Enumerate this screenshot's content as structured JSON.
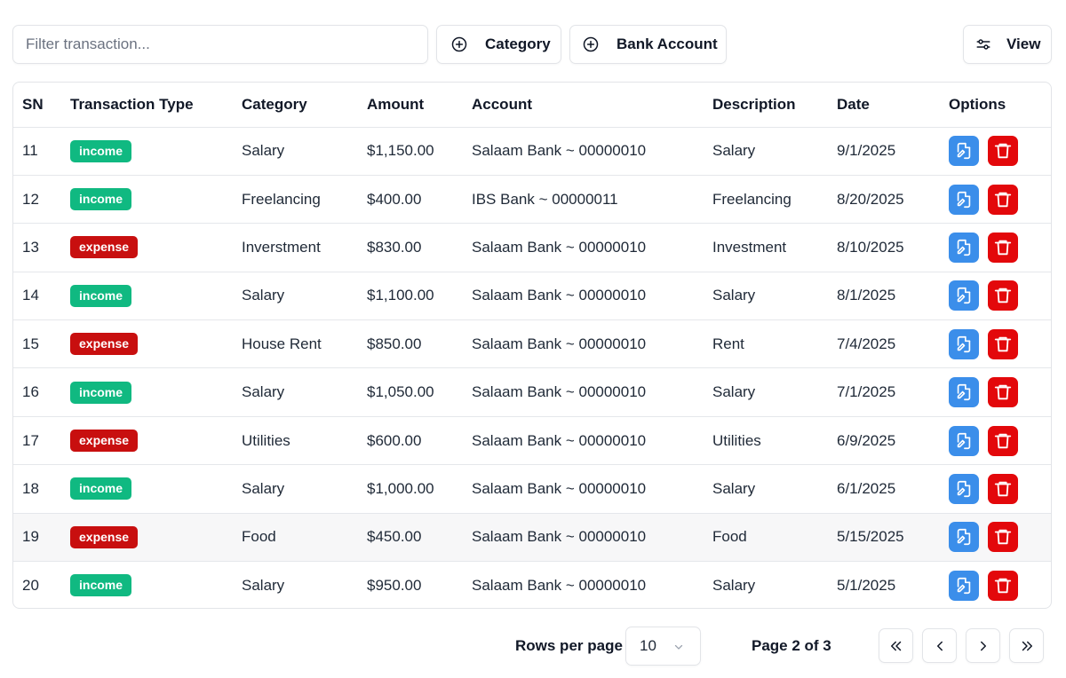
{
  "toolbar": {
    "filter_placeholder": "Filter transaction...",
    "category_label": "Category",
    "bank_account_label": "Bank Account",
    "view_label": "View"
  },
  "table": {
    "headers": [
      "SN",
      "Transaction Type",
      "Category",
      "Amount",
      "Account",
      "Description",
      "Date",
      "Options"
    ],
    "rows": [
      {
        "sn": "11",
        "type": "income",
        "category": "Salary",
        "amount": "$1,150.00",
        "account": "Salaam Bank ~ 00000010",
        "description": "Salary",
        "date": "9/1/2025"
      },
      {
        "sn": "12",
        "type": "income",
        "category": "Freelancing",
        "amount": "$400.00",
        "account": "IBS Bank ~ 00000011",
        "description": "Freelancing",
        "date": "8/20/2025"
      },
      {
        "sn": "13",
        "type": "expense",
        "category": "Inverstment",
        "amount": "$830.00",
        "account": "Salaam Bank ~ 00000010",
        "description": "Investment",
        "date": "8/10/2025"
      },
      {
        "sn": "14",
        "type": "income",
        "category": "Salary",
        "amount": "$1,100.00",
        "account": "Salaam Bank ~ 00000010",
        "description": "Salary",
        "date": "8/1/2025"
      },
      {
        "sn": "15",
        "type": "expense",
        "category": "House Rent",
        "amount": "$850.00",
        "account": "Salaam Bank ~ 00000010",
        "description": "Rent",
        "date": "7/4/2025"
      },
      {
        "sn": "16",
        "type": "income",
        "category": "Salary",
        "amount": "$1,050.00",
        "account": "Salaam Bank ~ 00000010",
        "description": "Salary",
        "date": "7/1/2025"
      },
      {
        "sn": "17",
        "type": "expense",
        "category": "Utilities",
        "amount": "$600.00",
        "account": "Salaam Bank ~ 00000010",
        "description": "Utilities",
        "date": "6/9/2025"
      },
      {
        "sn": "18",
        "type": "income",
        "category": "Salary",
        "amount": "$1,000.00",
        "account": "Salaam Bank ~ 00000010",
        "description": "Salary",
        "date": "6/1/2025"
      },
      {
        "sn": "19",
        "type": "expense",
        "category": "Food",
        "amount": "$450.00",
        "account": "Salaam Bank ~ 00000010",
        "description": "Food",
        "date": "5/15/2025",
        "hovered": true
      },
      {
        "sn": "20",
        "type": "income",
        "category": "Salary",
        "amount": "$950.00",
        "account": "Salaam Bank ~ 00000010",
        "description": "Salary",
        "date": "5/1/2025"
      }
    ]
  },
  "pagination": {
    "rows_per_page_label": "Rows per page",
    "rows_per_page_value": "10",
    "page_info": "Page 2 of 3"
  },
  "colors": {
    "income_badge": "#10b981",
    "expense_badge": "#c80f0f",
    "edit_button": "#3b8eea",
    "delete_button": "#e3080b"
  },
  "icons": {
    "add": "plus-circle-icon",
    "view": "sliders-icon",
    "edit": "file-edit-icon",
    "delete": "trash-icon"
  }
}
